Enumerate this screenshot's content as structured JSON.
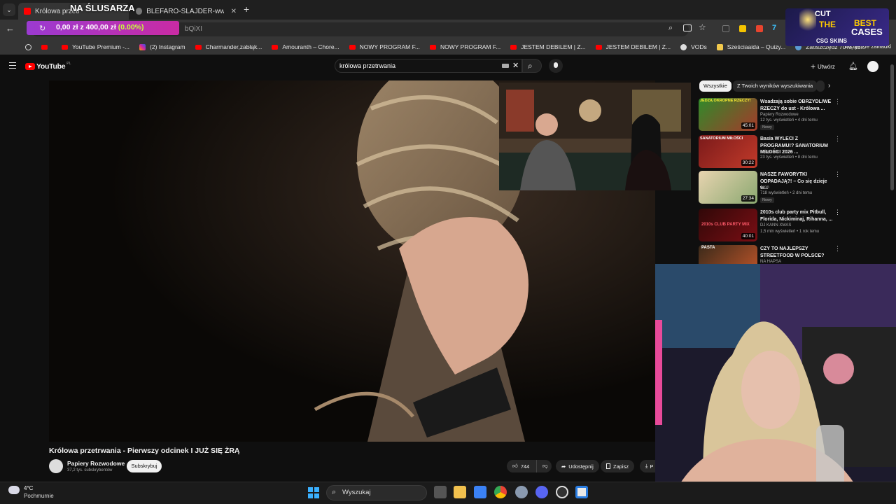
{
  "browser": {
    "tabs": [
      {
        "label": "Królowa przetr",
        "active": true
      },
      {
        "label": "BLEFARO-SLAJDER-www-c025",
        "active": false
      }
    ],
    "new_tab_label": "+",
    "address_fragment": "bQiXI",
    "bookmarks": [
      "YouTube Premium -...",
      "(2) Instagram",
      "Charmander,zabłąk...",
      "Amouranth – Chore...",
      "NOWY PROGRAM F...",
      "NOWY PROGRAM F...",
      "JESTEM DEBILEM | Z...",
      "JESTEM DEBILEM | Z...",
      "VODs",
      "Sześciaaida – Quizy...",
      "Zaoszczędź 70%, ku..."
    ],
    "all_bookmarks": "Wszystkie zakładki"
  },
  "overlay": {
    "title": "NA ŚLUSARZA",
    "goal_text": "0,00 zł z 400,00 zł",
    "goal_pct": "(0.00%)",
    "ad_line1": "CUT",
    "ad_line2": "THE",
    "ad_line3": "BEST",
    "ad_line4": "CASES",
    "ad_brand": "CSG SKINS"
  },
  "youtube": {
    "logo": "YouTube",
    "logo_region": "PL",
    "search_query": "królowa przetrwania",
    "create_label": "Utwórz",
    "video_title": "Królowa przetrwania - Pierwszy odcinek I JUŻ SIĘ ŻRĄ",
    "channel_name": "Papiery Rozwodowe",
    "channel_subs": "37,2 tys. subskrybentów",
    "subscribe_label": "Subskrybuj",
    "likes": "744",
    "share_label": "Udostępnij",
    "save_label": "Zapisz",
    "download_label": "P",
    "chips": [
      "Wszystkie",
      "Z Twoich wyników wyszukiwania"
    ],
    "related": [
      {
        "title": "Wsadzają sobie OBRZYDLIWE RZECZY do ust - Królowa ...",
        "channel": "Papiery Rozwodowe",
        "meta": "12 tys. wyświetleń • 4 dni temu",
        "badge": "Nowy",
        "duration": "45:01",
        "thumb_text": "JEDZĄ OKROPNE RZECZY!"
      },
      {
        "title": "Basia WYLECI Z PROGRAMU!? SANATORIUM MIŁOŚCI 2026 ...",
        "channel": "cojapacze",
        "meta": "23 tys. wyświetleń • 8 dni temu",
        "badge": "",
        "duration": "30:22",
        "thumb_text": "SANATORIUM MIŁOŚCI"
      },
      {
        "title": "NASZE FAWORYTKI ODPADAJĄ?! – Co się dzieje w...",
        "channel": "Aron",
        "meta": "718 wyświetleń • 2 dni temu",
        "badge": "Nowy",
        "duration": "27:34",
        "thumb_text": ""
      },
      {
        "title": "2010s club party mix Pitbull, Florida, Nickiminaj, Rihanna, ...",
        "channel": "DJ KANN XMAS",
        "meta": "1,5 mln wyświetleń • 1 rok temu",
        "badge": "",
        "duration": "40:01",
        "thumb_text": "2010s CLUB PARTY MIX"
      },
      {
        "title": "CZY TO NAJLEPSZY STREETFOOD W POLSCE?",
        "channel": "NA HAPSA",
        "meta": "",
        "badge": "",
        "duration": "",
        "thumb_text": "PASTA"
      }
    ]
  },
  "taskbar": {
    "temp": "4°C",
    "weather": "Pochmurnie",
    "search_placeholder": "Wyszukaj"
  },
  "colors": {
    "yt_red": "#ff0000",
    "bg": "#0f0f0f",
    "accent_purple": "#9b3ad1",
    "goal_green": "#c6ff3a"
  }
}
